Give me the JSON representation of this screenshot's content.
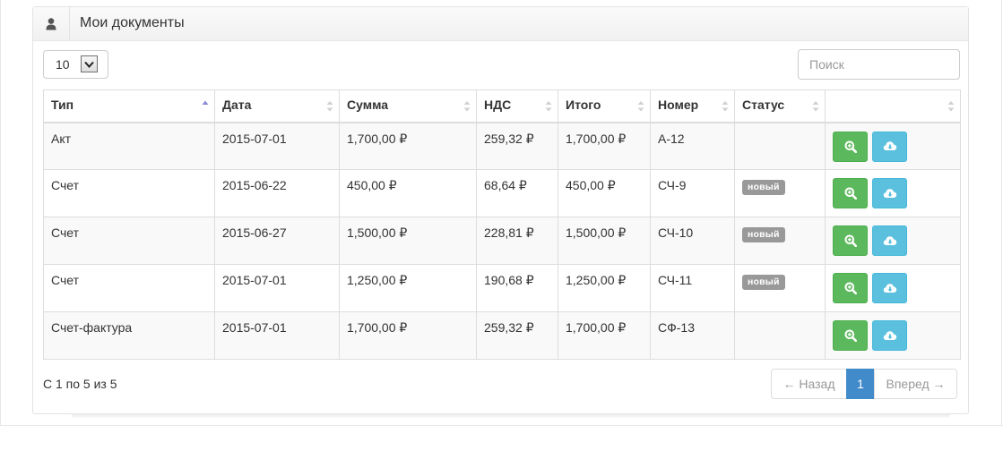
{
  "panel": {
    "title": "Мои документы",
    "icon": "user-icon"
  },
  "controls": {
    "page_length": "10",
    "search_placeholder": "Поиск"
  },
  "table": {
    "columns": [
      "Тип",
      "Дата",
      "Сумма",
      "НДС",
      "Итого",
      "Номер",
      "Статус",
      ""
    ],
    "rows": [
      {
        "type": "Акт",
        "date": "2015-07-01",
        "sum": "1,700,00 ₽",
        "vat": "259,32 ₽",
        "total": "1,700,00 ₽",
        "number": "А-12",
        "status": ""
      },
      {
        "type": "Счет",
        "date": "2015-06-22",
        "sum": "450,00 ₽",
        "vat": "68,64 ₽",
        "total": "450,00 ₽",
        "number": "СЧ-9",
        "status": "новый"
      },
      {
        "type": "Счет",
        "date": "2015-06-27",
        "sum": "1,500,00 ₽",
        "vat": "228,81 ₽",
        "total": "1,500,00 ₽",
        "number": "СЧ-10",
        "status": "новый"
      },
      {
        "type": "Счет",
        "date": "2015-07-01",
        "sum": "1,250,00 ₽",
        "vat": "190,68 ₽",
        "total": "1,250,00 ₽",
        "number": "СЧ-11",
        "status": "новый"
      },
      {
        "type": "Счет-фактура",
        "date": "2015-07-01",
        "sum": "1,700,00 ₽",
        "vat": "259,32 ₽",
        "total": "1,700,00 ₽",
        "number": "СФ-13",
        "status": ""
      }
    ]
  },
  "footer": {
    "info": "С 1 по 5 из 5",
    "prev": "← Назад",
    "page": "1",
    "next": "Вперед →"
  },
  "colors": {
    "view_button": "#5cb85c",
    "download_button": "#5bc0de",
    "badge": "#999999",
    "active_page": "#428bca"
  }
}
